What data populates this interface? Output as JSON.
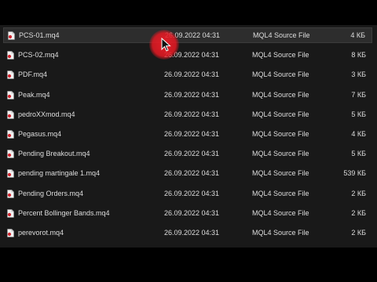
{
  "files": [
    {
      "name": "PCS-01.mq4",
      "date": "26.09.2022 04:31",
      "type": "MQL4 Source File",
      "size": "4 КБ",
      "selected": true
    },
    {
      "name": "PCS-02.mq4",
      "date": "26.09.2022 04:31",
      "type": "MQL4 Source File",
      "size": "8 КБ"
    },
    {
      "name": "PDF.mq4",
      "date": "26.09.2022 04:31",
      "type": "MQL4 Source File",
      "size": "3 КБ"
    },
    {
      "name": "Peak.mq4",
      "date": "26.09.2022 04:31",
      "type": "MQL4 Source File",
      "size": "7 КБ"
    },
    {
      "name": "pedroXXmod.mq4",
      "date": "26.09.2022 04:31",
      "type": "MQL4 Source File",
      "size": "5 КБ"
    },
    {
      "name": "Pegasus.mq4",
      "date": "26.09.2022 04:31",
      "type": "MQL4 Source File",
      "size": "4 КБ"
    },
    {
      "name": "Pending Breakout.mq4",
      "date": "26.09.2022 04:31",
      "type": "MQL4 Source File",
      "size": "5 КБ"
    },
    {
      "name": "pending martingale 1.mq4",
      "date": "26.09.2022 04:31",
      "type": "MQL4 Source File",
      "size": "539 КБ"
    },
    {
      "name": "Pending Orders.mq4",
      "date": "26.09.2022 04:31",
      "type": "MQL4 Source File",
      "size": "2 КБ"
    },
    {
      "name": "Percent Bollinger Bands.mq4",
      "date": "26.09.2022 04:31",
      "type": "MQL4 Source File",
      "size": "2 КБ"
    },
    {
      "name": "perevorot.mq4",
      "date": "26.09.2022 04:31",
      "type": "MQL4 Source File",
      "size": "2 КБ"
    }
  ],
  "icons": {
    "file": "mq4-file-icon",
    "cursor": "mouse-pointer-icon"
  },
  "colors": {
    "background": "#191919",
    "text": "#dedede",
    "selected_row": "#2d2d2d",
    "cursor_highlight": "#eb1e28",
    "icon_accent": "#d2252e"
  }
}
